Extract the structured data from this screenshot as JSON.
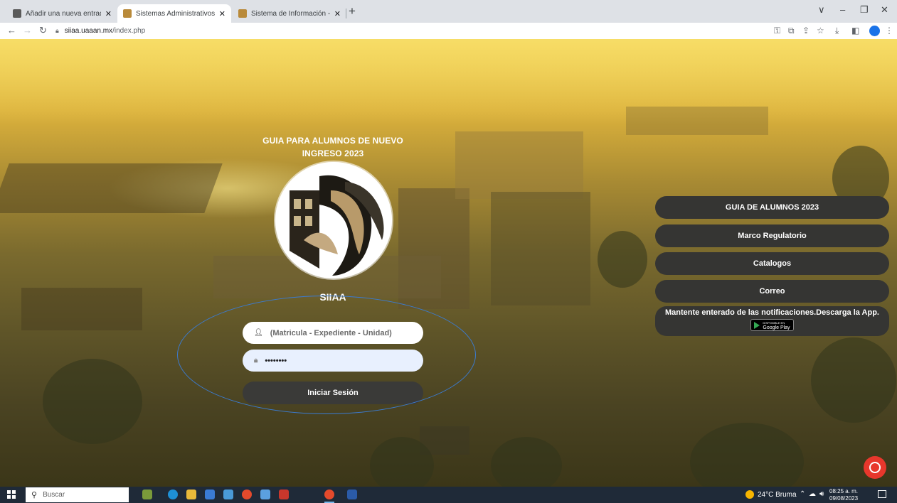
{
  "browser": {
    "tabs": [
      {
        "title": "Añadir una nueva entrada ‹ Uni",
        "active": false
      },
      {
        "title": "Sistemas Administrativos -UAAA",
        "active": true
      },
      {
        "title": "Sistema de Información - UAAAN",
        "active": false
      }
    ],
    "new_tab": "+",
    "url_host": "siiaa.uaaan.mx",
    "url_path": "/index.php",
    "window_controls": {
      "minimize": "–",
      "restore": "❐",
      "close": "✕",
      "tab_search": "∨"
    }
  },
  "page": {
    "guide_heading": "GUIA PARA ALUMNOS DE NUEVO INGRESO 2023",
    "system_name": "SIIAA",
    "login": {
      "user_placeholder": "(Matricula - Expediente - Unidad)",
      "password_value": "••••••••",
      "submit_label": "Iniciar Sesión"
    },
    "side_menu": [
      {
        "label": "GUIA DE ALUMNOS 2023"
      },
      {
        "label": "Marco Regulatorio"
      },
      {
        "label": "Catalogos"
      },
      {
        "label": "Correo"
      }
    ],
    "app_notice": {
      "text": "Mantente enterado de las notificaciones.Descarga la App.",
      "store_badge_small": "DISPONIBLE EN",
      "store_badge": "Google Play"
    }
  },
  "taskbar": {
    "search_placeholder": "Buscar",
    "weather": "24°C  Bruma",
    "time": "08:25 a. m.",
    "date": "09/08/2023"
  },
  "colors": {
    "accent_blue": "#3b7bd1",
    "dark_button": "#353533",
    "notification_red": "#e8372c"
  }
}
